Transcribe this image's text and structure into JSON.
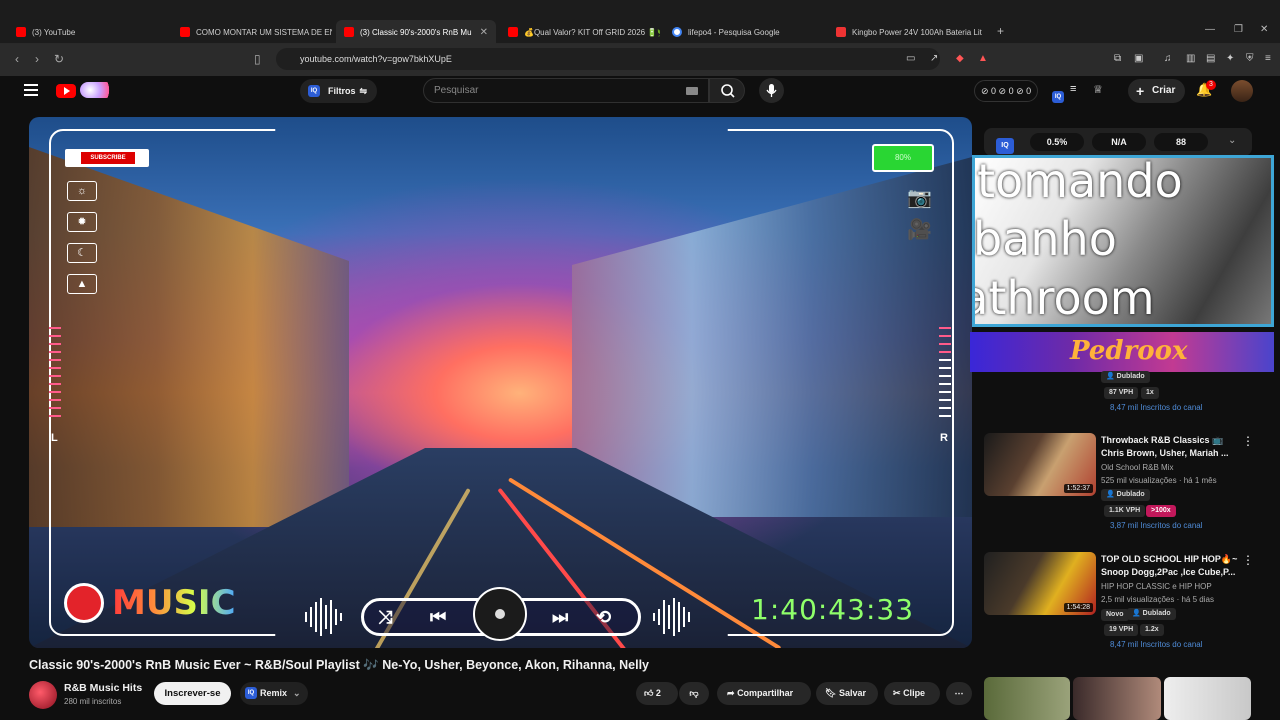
{
  "browser": {
    "tabs": [
      {
        "label": "(3) YouTube",
        "fav": "yt"
      },
      {
        "label": "COMO MONTAR UM SISTEMA DE EN",
        "fav": "yt"
      },
      {
        "label": "(3) Classic 90's-2000's RnB Mu",
        "fav": "yt",
        "active": true
      },
      {
        "label": "💰Qual Valor? KIT Off GRID 2026 🔋🌿",
        "fav": "yt"
      },
      {
        "label": "lifepo4 - Pesquisa Google",
        "fav": "g"
      },
      {
        "label": "Kingbo Power 24V 100Ah Bateria Lit",
        "fav": "kb"
      }
    ],
    "url": "youtube.com/watch?v=gow7bkhXUpE",
    "new_tab_icon": "+"
  },
  "yt_header": {
    "filtros_label": "Filtros",
    "iq_label": "IQ",
    "search_placeholder": "Pesquisar",
    "stats_text": "⊘ 0  ⊘ 0  ⊘ 0",
    "criar_label": "Criar",
    "notification_count": "3"
  },
  "player": {
    "subscribe_label": "SUBSCRIBE",
    "battery_label": "80%",
    "left_label": "L",
    "right_label": "R",
    "music_label": "MUSIC",
    "timer": "1:40:43:33"
  },
  "sidebar": {
    "iq_stats": [
      "0.5%",
      "N/A",
      "88"
    ],
    "cam_lines": [
      "tomando",
      "banho",
      "bathroom"
    ],
    "banner_text": "Pedroox",
    "first_item": {
      "badge": "Dublado",
      "vph": "87 VPH",
      "mult": "1x",
      "subs": "8,47 mil Inscritos do canal"
    },
    "items": [
      {
        "title": "Throwback R&B Classics 📺 Chris Brown, Usher, Mariah ...",
        "channel": "Old School R&B Mix",
        "meta": "525 mil visualizações · há 1 mês",
        "duration": "1:52:37",
        "badge": "Dublado",
        "vph": "1.1K VPH",
        "mult": ">100x",
        "subs": "3,87 mil Inscritos do canal"
      },
      {
        "title": "TOP OLD SCHOOL HIP HOP🔥~ Snoop Dogg,2Pac ,Ice Cube,P...",
        "channel": "HIP HOP CLASSIC e HIP HOP",
        "meta": "2,5 mil visualizações · há 5 dias",
        "duration": "1:54:28",
        "new_label": "Novo",
        "badge": "Dublado",
        "vph": "19 VPH",
        "mult": "1.2x",
        "subs": "8,47 mil Inscritos do canal"
      }
    ]
  },
  "video": {
    "title": "Classic 90's-2000's RnB Music Ever ~ R&B/Soul Playlist 🎶 Ne-Yo, Usher, Beyonce, Akon, Rihanna, Nelly",
    "channel": "R&B Music Hits",
    "subs": "280 mil inscritos",
    "subscribe_label": "Inscrever-se",
    "remix_label": "Remix",
    "likes": "2",
    "share_label": "Compartilhar",
    "save_label": "Salvar",
    "clip_label": "Clipe"
  }
}
